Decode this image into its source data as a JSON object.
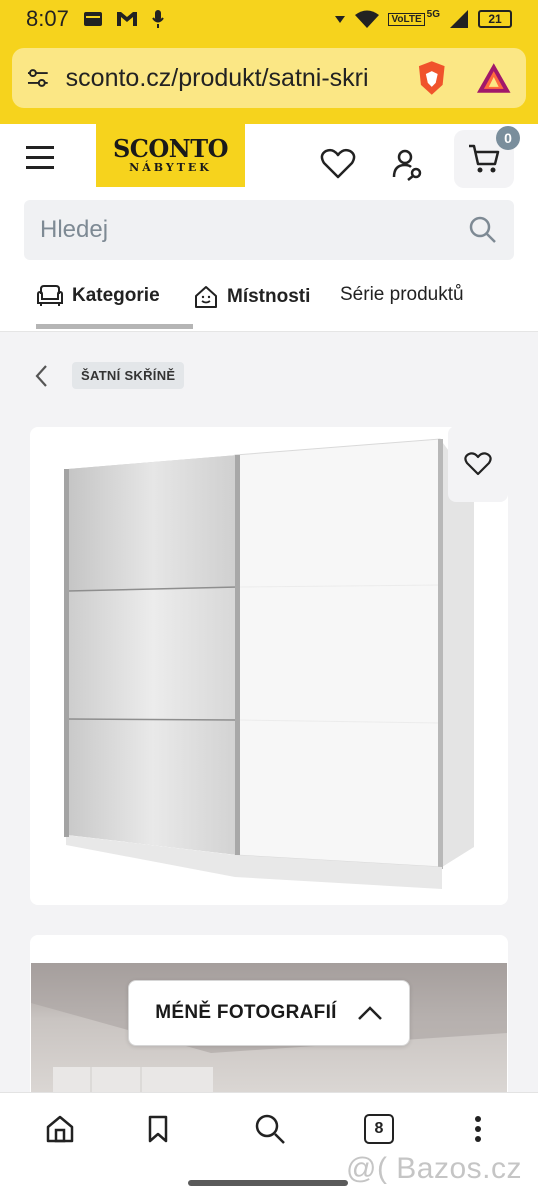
{
  "status_bar": {
    "time": "8:07",
    "battery": "21",
    "network": "5G",
    "volte": "VoLTE"
  },
  "browser": {
    "url": "sconto.cz/produkt/satni-skri"
  },
  "header": {
    "logo_line1": "SCONTO",
    "logo_line2": "NÁBYTEK",
    "cart_count": "0"
  },
  "search": {
    "placeholder": "Hledej"
  },
  "tabs": [
    {
      "label": "Kategorie",
      "icon": "sofa-icon"
    },
    {
      "label": "Místnosti",
      "icon": "smile-icon"
    },
    {
      "label": "Série produktů",
      "icon": ""
    }
  ],
  "breadcrumb": {
    "label": "ŠATNÍ SKŘÍNĚ"
  },
  "gallery": {
    "toggle_label": "MÉNĚ FOTOGRAFIÍ"
  },
  "bottom_nav": {
    "tab_count": "8"
  },
  "watermark": "@( Bazos.cz",
  "colors": {
    "brand_yellow": "#f6d31d",
    "badge_gray": "#7a8e9c"
  }
}
